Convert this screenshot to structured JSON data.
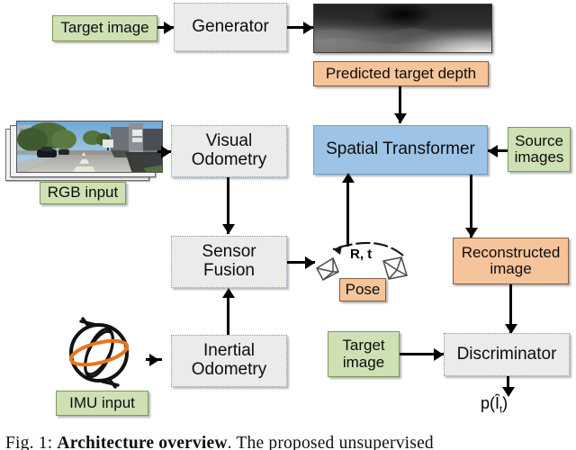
{
  "figure": {
    "caption_prefix": "Fig. 1:",
    "caption_bold": "Architecture overview",
    "caption_rest": ". The proposed unsupervised"
  },
  "nodes": {
    "target_image_top": {
      "label": "Target image",
      "kind": "input",
      "color": "#cfe0b4"
    },
    "generator": {
      "label": "Generator",
      "kind": "process",
      "color": "#ebebeb"
    },
    "predicted_depth": {
      "label": "Predicted target depth",
      "kind": "data",
      "color": "#f6c49b"
    },
    "depth_image": {
      "label": "predicted-depth-map"
    },
    "rgb_photo": {
      "label": "rgb-image-stack"
    },
    "rgb_input": {
      "label": "RGB input",
      "kind": "input",
      "color": "#cfe0b4"
    },
    "visual_odometry": {
      "label": "Visual\nOdometry",
      "kind": "process",
      "color": "#ebebeb"
    },
    "spatial_transformer": {
      "label": "Spatial Transformer",
      "kind": "process",
      "color": "#9dc3e6"
    },
    "source_images": {
      "label": "Source\nimages",
      "kind": "input",
      "color": "#cfe0b4"
    },
    "sensor_fusion": {
      "label": "Sensor\nFusion",
      "kind": "process",
      "color": "#ebebeb"
    },
    "pose": {
      "label": "Pose",
      "kind": "data",
      "color": "#f6c49b"
    },
    "rt_label": {
      "label": "R, t"
    },
    "reconstructed_image": {
      "label": "Reconstructed\nimage",
      "kind": "data",
      "color": "#f6c49b"
    },
    "imu_icon": {
      "label": "gyroscope-icon"
    },
    "imu_input": {
      "label": "IMU input",
      "kind": "input",
      "color": "#cfe0b4"
    },
    "inertial_odometry": {
      "label": "Inertial\nOdometry",
      "kind": "process",
      "color": "#ebebeb"
    },
    "target_image_bottom": {
      "label": "Target\nimage",
      "kind": "input",
      "color": "#cfe0b4"
    },
    "discriminator": {
      "label": "Discriminator",
      "kind": "process",
      "color": "#ebebeb"
    },
    "output_prob": {
      "label": "p(Î",
      "label_sub": "t",
      "label_tail": ")"
    }
  },
  "edges": [
    {
      "from": "target_image_top",
      "to": "generator",
      "dir": "right"
    },
    {
      "from": "generator",
      "to": "depth_image",
      "dir": "right"
    },
    {
      "from": "predicted_depth",
      "to": "spatial_transformer",
      "dir": "down"
    },
    {
      "from": "rgb_photo",
      "to": "visual_odometry",
      "dir": "right"
    },
    {
      "from": "visual_odometry",
      "to": "sensor_fusion",
      "dir": "down"
    },
    {
      "from": "inertial_odometry",
      "to": "sensor_fusion",
      "dir": "up"
    },
    {
      "from": "imu_icon",
      "to": "inertial_odometry",
      "dir": "right"
    },
    {
      "from": "sensor_fusion",
      "to": "pose",
      "dir": "right"
    },
    {
      "from": "pose",
      "to": "spatial_transformer",
      "dir": "up"
    },
    {
      "from": "source_images",
      "to": "spatial_transformer",
      "dir": "left"
    },
    {
      "from": "spatial_transformer",
      "to": "reconstructed_image",
      "dir": "down"
    },
    {
      "from": "reconstructed_image",
      "to": "discriminator",
      "dir": "down"
    },
    {
      "from": "target_image_bottom",
      "to": "discriminator",
      "dir": "right"
    },
    {
      "from": "discriminator",
      "to": "output_prob",
      "dir": "down"
    }
  ],
  "colors": {
    "input_green": "#cfe0b4",
    "process_grey": "#ebebeb",
    "data_orange": "#f6c49b",
    "transformer_blue": "#9dc3e6",
    "imu_orange": "#e8761c",
    "line_black": "#000000"
  }
}
